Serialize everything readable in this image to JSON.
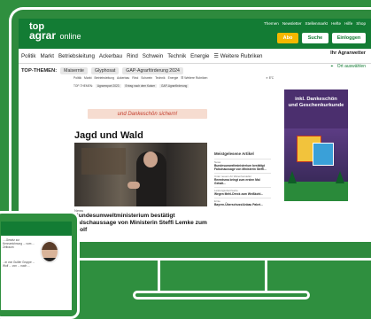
{
  "header": {
    "logo": {
      "line1": "top",
      "line2": "agrar",
      "line3": "online"
    },
    "toplinks": [
      "Themen",
      "Newsletter",
      "Stellenmarkt",
      "Hefte",
      "Hilfe",
      "Shop"
    ],
    "buttons": {
      "abo": "Abo",
      "search": "Suche",
      "login": "Einloggen"
    },
    "brand_color": "#137c34",
    "accent_color": "#f5b800"
  },
  "nav": {
    "items": [
      "Politik",
      "Markt",
      "Betriebsleitung",
      "Ackerbau",
      "Rind",
      "Schwein",
      "Technik",
      "Energie",
      "☰ Weitere Rubriken"
    ],
    "weather_title": "Ihr Agrarwetter",
    "weather_link": "Ort auswählen",
    "weather_icon": "location-icon"
  },
  "topics": {
    "label": "TOP-THEMEN:",
    "chips": [
      "Maisernte",
      "Glyphosat",
      "GAP-Agrarförderung 2024"
    ]
  },
  "inner": {
    "nav": [
      "Politik",
      "Markt",
      "Betriebsleitung",
      "Ackerbau",
      "Rind",
      "Schwein",
      "Technik",
      "Energie",
      "☰ Weitere Rubriken"
    ],
    "weather": "☀ 8°C",
    "topics_label": "TOP-THEMEN:",
    "topics": [
      "Agrarexport 2023",
      "Ertrag nach dem Kaiser",
      "GAP-Agrarförderung"
    ]
  },
  "banner": {
    "text": "und Dankeschön sichern!"
  },
  "section": {
    "title": "Jagd und Wald"
  },
  "article": {
    "label": "News",
    "headline": "Bundesumweltministerium bestätigt Falschaussage von Ministerin Steffi Lemke zum Wolf"
  },
  "sidebar": {
    "title": "Meistgelesene Artikel",
    "items": [
      {
        "kicker": "News",
        "title": "Bundesumweltministerium bestätigt Falschaussage von Ministerin Steffi..."
      },
      {
        "kicker": "Unter neuem Air Warenhersteller",
        "title": "Reemtsma bringt zum ersten Mal Gehalt..."
      },
      {
        "kicker": "Leistungsoberzwerte",
        "title": "Wegen Mehl-Dreck zum Weißkohl..."
      },
      {
        "kicker": "Ernte",
        "title": "Bayern-Überschuss/Anbau Paket..."
      }
    ]
  },
  "ad": {
    "line1": "inkl. Dankeschön",
    "line2": "und Geschenkurkunde"
  },
  "tablet": {
    "text1": "...-Gesetz zur Kennzeichnung ... vom ... Zeitraum",
    "text2": "...in von Guiller Gruppe ... Wolf ... von ... nach ..."
  }
}
